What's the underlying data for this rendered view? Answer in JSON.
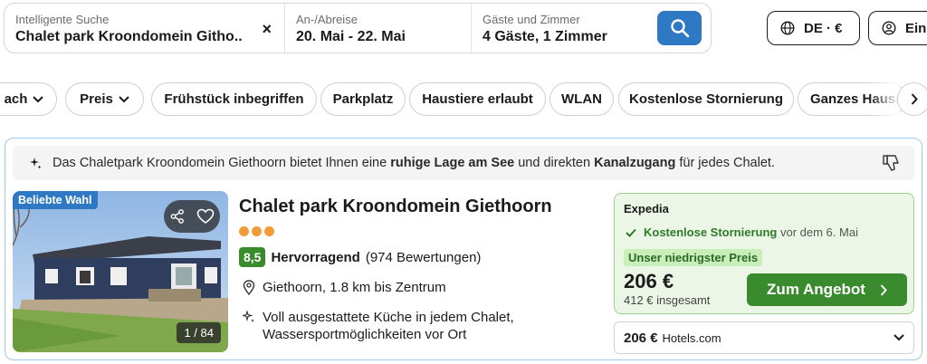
{
  "search": {
    "destination_label": "Intelligente Suche",
    "destination_value": "Chalet park Kroondomein Githo...",
    "dates_label": "An-/Abreise",
    "dates_value": "20. Mai - 22. Mai",
    "guests_label": "Gäste und Zimmer",
    "guests_value": "4 Gäste, 1 Zimmer",
    "clear_glyph": "×"
  },
  "header": {
    "language_currency": "DE · €",
    "login_label": "Ein"
  },
  "filters": [
    {
      "label": "ach",
      "has_chevron": true
    },
    {
      "label": "Preis",
      "has_chevron": true
    },
    {
      "label": "Frühstück inbegriffen"
    },
    {
      "label": "Parkplatz"
    },
    {
      "label": "Haustiere erlaubt"
    },
    {
      "label": "WLAN"
    },
    {
      "label": "Kostenlose Stornierung"
    },
    {
      "label": "Ganzes Haus/"
    }
  ],
  "card": {
    "banner": {
      "part1": "Das Chaletpark Kroondomein Giethoorn bietet Ihnen eine ",
      "bold1": "ruhige Lage am See",
      "part2": " und direkten ",
      "bold2": "Kanalzugang",
      "part3": " für jedes Chalet."
    },
    "photo_badge": "Beliebte Wahl",
    "photo_counter": "1 / 84",
    "title": "Chalet park Kroondomein Giethoorn",
    "stars": 3,
    "score": "8,5",
    "rating_word": "Hervorragend",
    "review_count": "(974 Bewertungen)",
    "location": "Giethoorn, 1.8 km bis Zentrum",
    "feature_line1": "Voll ausgestattete Küche in jedem Chalet,",
    "feature_line2": "Wassersportmöglichkeiten vor Ort",
    "deal": {
      "provider": "Expedia",
      "cancel_text": "Kostenlose Stornierung",
      "cancel_deadline": "vor dem 6. Mai",
      "lowest_badge": "Unser niedrigster Preis",
      "price": "206 €",
      "total": "412 € insgesamt",
      "cta_label": "Zum Angebot"
    },
    "alt_offer": {
      "price": "206 €",
      "provider": "Hotels.com"
    }
  },
  "colors": {
    "accent_blue": "#2f79c4",
    "green": "#3a8a2e",
    "star_orange": "#f29b38"
  }
}
